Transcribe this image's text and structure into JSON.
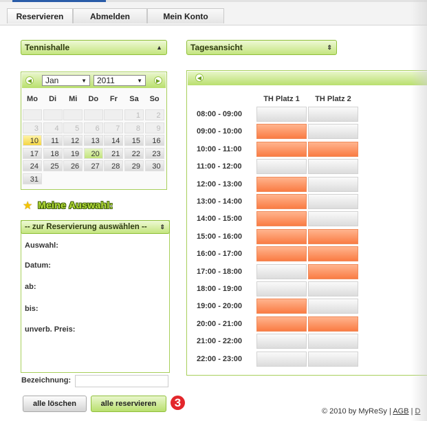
{
  "tabs": [
    {
      "label": "Reservieren",
      "active": true
    },
    {
      "label": "Abmelden",
      "active": false
    },
    {
      "label": "Mein Konto",
      "active": false
    }
  ],
  "hall_select": {
    "value": "Tennishalle"
  },
  "view_select": {
    "value": "Tagesansicht"
  },
  "calendar": {
    "month": "Jan",
    "year": "2011",
    "weekdays": [
      "Mo",
      "Di",
      "Mi",
      "Do",
      "Fr",
      "Sa",
      "So"
    ],
    "weeks": [
      [
        "",
        "",
        "",
        "",
        "",
        "1",
        "2"
      ],
      [
        "3",
        "4",
        "5",
        "6",
        "7",
        "8",
        "9"
      ],
      [
        "10",
        "11",
        "12",
        "13",
        "14",
        "15",
        "16"
      ],
      [
        "17",
        "18",
        "19",
        "20",
        "21",
        "22",
        "23"
      ],
      [
        "24",
        "25",
        "26",
        "27",
        "28",
        "29",
        "30"
      ],
      [
        "31",
        "",
        "",
        "",
        "",
        "",
        ""
      ]
    ],
    "today": "10",
    "selected": "20"
  },
  "selection": {
    "title": "Meine Auswahl:",
    "dropdown": "-- zur Reservierung auswählen --",
    "fields": [
      "Auswahl:",
      "Datum:",
      "ab:",
      "bis:",
      "unverb. Preis:"
    ],
    "bezeichnung_label": "Bezeichnung:",
    "bezeichnung_value": ""
  },
  "buttons": {
    "clear": "alle löschen",
    "reserve": "alle reservieren"
  },
  "badge": "3",
  "schedule": {
    "courts": [
      "TH Platz 1",
      "TH Platz 2"
    ],
    "slots": [
      {
        "time": "08:00 - 09:00",
        "status": [
          "free",
          "free"
        ]
      },
      {
        "time": "09:00 - 10:00",
        "status": [
          "booked",
          "free"
        ]
      },
      {
        "time": "10:00 - 11:00",
        "status": [
          "booked",
          "booked"
        ]
      },
      {
        "time": "11:00 - 12:00",
        "status": [
          "free",
          "free"
        ]
      },
      {
        "time": "12:00 - 13:00",
        "status": [
          "booked",
          "free"
        ]
      },
      {
        "time": "13:00 - 14:00",
        "status": [
          "booked",
          "free"
        ]
      },
      {
        "time": "14:00 - 15:00",
        "status": [
          "booked",
          "free"
        ]
      },
      {
        "time": "15:00 - 16:00",
        "status": [
          "booked",
          "booked"
        ]
      },
      {
        "time": "16:00 - 17:00",
        "status": [
          "booked",
          "booked"
        ]
      },
      {
        "time": "17:00 - 18:00",
        "status": [
          "free",
          "booked"
        ]
      },
      {
        "time": "18:00 - 19:00",
        "status": [
          "free",
          "free"
        ]
      },
      {
        "time": "19:00 - 20:00",
        "status": [
          "booked",
          "free"
        ]
      },
      {
        "time": "20:00 - 21:00",
        "status": [
          "booked",
          "booked"
        ]
      },
      {
        "time": "21:00 - 22:00",
        "status": [
          "free",
          "free"
        ]
      },
      {
        "time": "22:00 - 23:00",
        "status": [
          "free",
          "free"
        ]
      }
    ]
  },
  "footer": {
    "copyright": "© 2010 by MyReSy",
    "sep": "|",
    "agb": "AGB",
    "more": "D"
  },
  "colors": {
    "accent_green": "#b9df6e",
    "booked": "#fa7c44",
    "free": "#dcdcdc",
    "badge": "#e3262b"
  }
}
